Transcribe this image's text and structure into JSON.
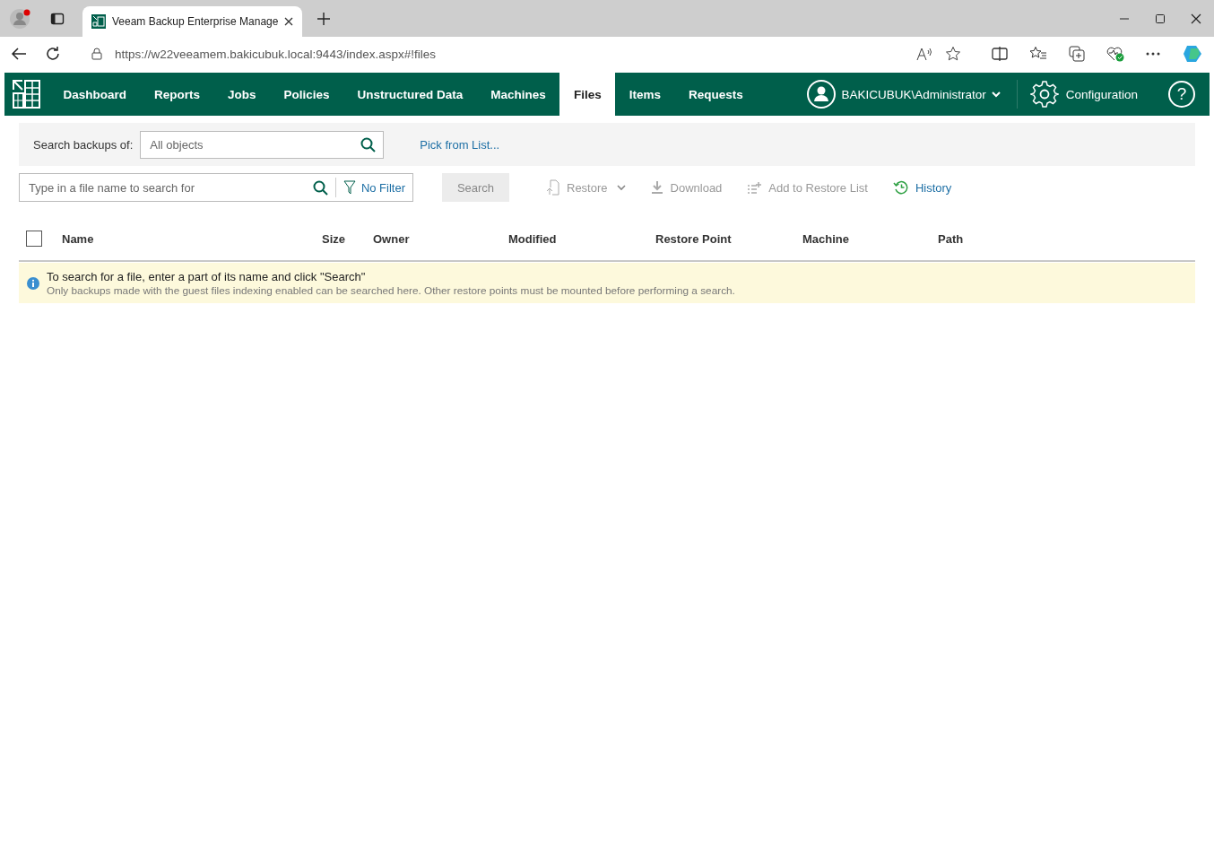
{
  "browser": {
    "tab_title": "Veeam Backup Enterprise Manage",
    "url": "https://w22veeamem.bakicubuk.local:9443/index.aspx#!files"
  },
  "nav": {
    "items": [
      {
        "label": "Dashboard",
        "selected": false
      },
      {
        "label": "Reports",
        "selected": false
      },
      {
        "label": "Jobs",
        "selected": false
      },
      {
        "label": "Policies",
        "selected": false
      },
      {
        "label": "Unstructured Data",
        "selected": false
      },
      {
        "label": "Machines",
        "selected": false
      },
      {
        "label": "Files",
        "selected": true
      },
      {
        "label": "Items",
        "selected": false
      },
      {
        "label": "Requests",
        "selected": false
      }
    ],
    "user": "BAKICUBUK\\Administrator",
    "configuration": "Configuration",
    "help": "?"
  },
  "scope": {
    "label": "Search backups of:",
    "placeholder": "All objects",
    "link": "Pick from List..."
  },
  "file_search": {
    "placeholder": "Type in a file name to search for",
    "filter": "No Filter",
    "search_button": {
      "label": "Search",
      "disabled": true
    }
  },
  "actions": [
    {
      "kind": "restore",
      "label": "Restore",
      "disabled": true,
      "dropdown": true
    },
    {
      "kind": "download",
      "label": "Download",
      "disabled": true,
      "dropdown": false
    },
    {
      "kind": "add",
      "label": "Add to Restore List",
      "disabled": true,
      "dropdown": false
    },
    {
      "kind": "history",
      "label": "History",
      "disabled": false,
      "dropdown": false
    }
  ],
  "table": {
    "select_all": {
      "checked": false
    },
    "columns": [
      "Name",
      "Size",
      "Owner",
      "Modified",
      "Restore Point",
      "Machine",
      "Path"
    ]
  },
  "info": {
    "title": "To search for a file, enter a part of its name and click \"Search\"",
    "detail": "Only backups made with the guest files indexing enabled can be searched here. Other restore points must be mounted before performing a search."
  }
}
